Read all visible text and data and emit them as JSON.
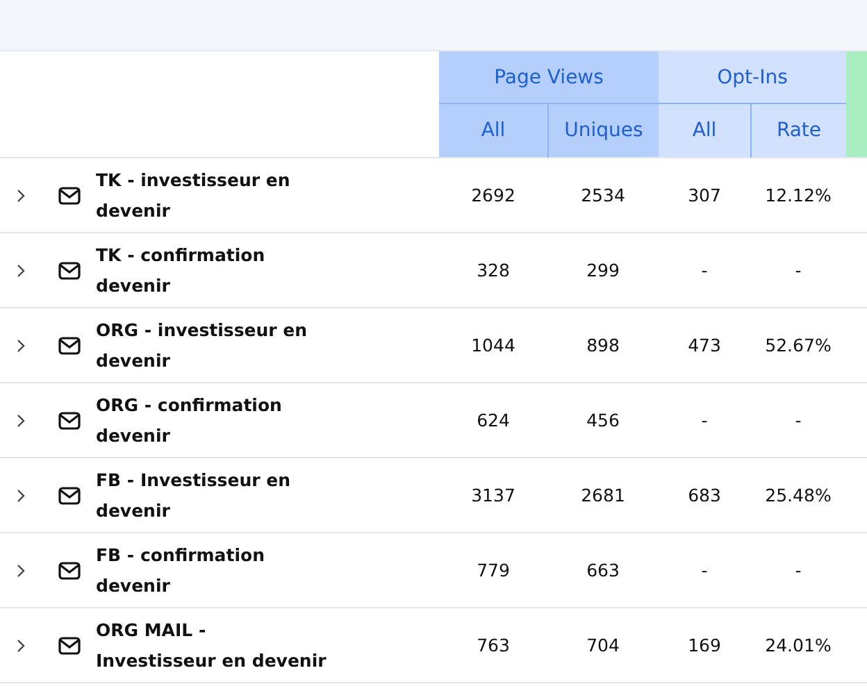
{
  "column_groups": [
    {
      "label": "Page Views",
      "color": "#b4cffb",
      "columns": [
        "All",
        "Uniques"
      ]
    },
    {
      "label": "Opt-Ins",
      "color": "#d2e1fd",
      "columns": [
        "All",
        "Rate"
      ]
    },
    {
      "color": "#a8eec0"
    }
  ],
  "rows": [
    {
      "name": "TK - investisseur en\ndevenir",
      "values": [
        "2692",
        "2534",
        "307",
        "12.12%"
      ]
    },
    {
      "name": "TK - confirmation\ndevenir",
      "values": [
        "328",
        "299",
        "-",
        "-"
      ]
    },
    {
      "name": "ORG - investisseur en\ndevenir",
      "values": [
        "1044",
        "898",
        "473",
        "52.67%"
      ]
    },
    {
      "name": "ORG - confirmation\ndevenir",
      "values": [
        "624",
        "456",
        "-",
        "-"
      ]
    },
    {
      "name": "FB - Investisseur en\ndevenir",
      "values": [
        "3137",
        "2681",
        "683",
        "25.48%"
      ]
    },
    {
      "name": "FB - confirmation\ndevenir",
      "values": [
        "779",
        "663",
        "-",
        "-"
      ]
    },
    {
      "name": "ORG MAIL -\nInvestisseur en devenir",
      "values": [
        "763",
        "704",
        "169",
        "24.01%"
      ]
    }
  ]
}
